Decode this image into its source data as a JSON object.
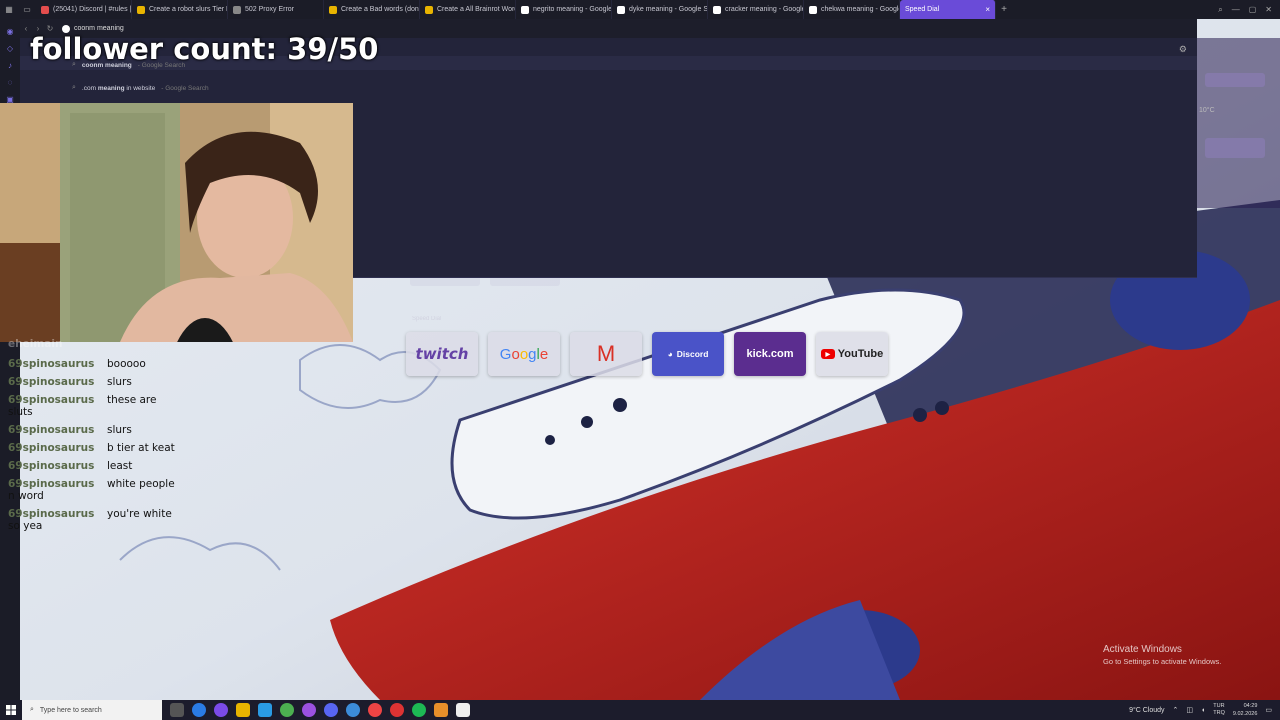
{
  "browser": {
    "tabs": [
      {
        "title": "(25041) Discord | #rules |",
        "color": "#e34d4d"
      },
      {
        "title": "Create a robot slurs Tier L",
        "color": "#e8b400"
      },
      {
        "title": "502 Proxy Error",
        "color": "#888888"
      },
      {
        "title": "Create a Bad words (don't",
        "color": "#e8b400"
      },
      {
        "title": "Create a All Brainrot Word",
        "color": "#e8b400"
      },
      {
        "title": "negrito meaning - Google",
        "color": "#ffffff"
      },
      {
        "title": "dyke meaning - Google S",
        "color": "#ffffff"
      },
      {
        "title": "cracker meaning - Google",
        "color": "#ffffff"
      },
      {
        "title": "chekwa meaning - Google",
        "color": "#ffffff"
      }
    ],
    "active_tab": {
      "title": "Speed Dial",
      "close": "×"
    },
    "new_tab": "+",
    "address": "coonm meaning",
    "suggestions": [
      {
        "bold": "coonm meaning",
        "text": "",
        "source": "- Google Search"
      },
      {
        "bold": "meaning",
        "text": ".com ",
        "suffix": " in website",
        "source": "- Google Search"
      }
    ]
  },
  "overlay": {
    "follower_count": "follower count: 39/50"
  },
  "speed_dial": {
    "section_label": "Speed Dial",
    "tiles": [
      {
        "name": "twitch",
        "label": "twitch"
      },
      {
        "name": "google",
        "label": "Google"
      },
      {
        "name": "gmail",
        "label": "M"
      },
      {
        "name": "discord",
        "label": "Discord"
      },
      {
        "name": "kick",
        "label": "kick.com"
      },
      {
        "name": "youtube",
        "label": "YouTube"
      }
    ]
  },
  "right_panel": {
    "temp": "10°C"
  },
  "chat": {
    "top_user": "eheimain",
    "messages": [
      {
        "user": "69spinosaurus",
        "text": "booooo",
        "cont": ""
      },
      {
        "user": "69spinosaurus",
        "text": "slurs",
        "cont": ""
      },
      {
        "user": "69spinosaurus",
        "text": "these are",
        "cont": "sluts"
      },
      {
        "user": "69spinosaurus",
        "text": "slurs",
        "cont": ""
      },
      {
        "user": "69spinosaurus",
        "text": "b tier at keat",
        "cont": ""
      },
      {
        "user": "69spinosaurus",
        "text": "least",
        "cont": ""
      },
      {
        "user": "69spinosaurus",
        "text": "white people",
        "cont": "n word"
      },
      {
        "user": "69spinosaurus",
        "text": "you're white",
        "cont": "so yea"
      }
    ]
  },
  "watermark": {
    "title": "Activate Windows",
    "subtitle": "Go to Settings to activate Windows."
  },
  "taskbar": {
    "search_placeholder": "Type here to search",
    "weather": "9°C  Cloudy",
    "lang": "TUR\nTRQ",
    "time": "04:29",
    "date": "9.02.2026"
  }
}
